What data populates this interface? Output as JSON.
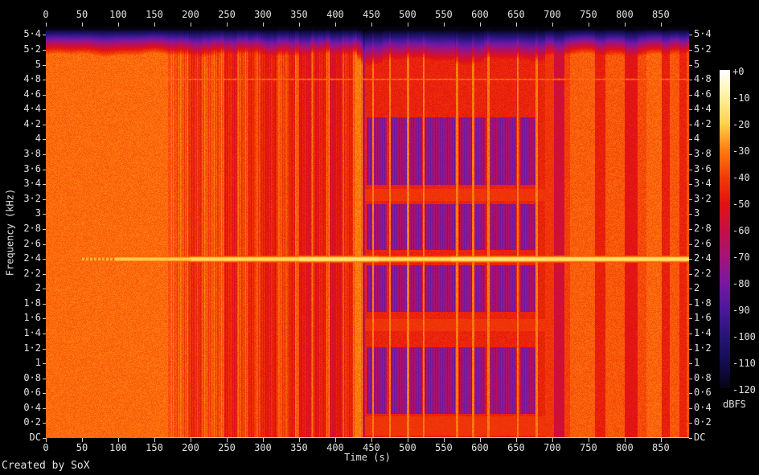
{
  "window": {
    "credit": "Created by SoX",
    "background": "#000000",
    "text_color": "#e2e2e2"
  },
  "chart_data": {
    "type": "heatmap",
    "subtype": "audio-spectrogram",
    "title": "",
    "x_axis": {
      "label": "Time (s)",
      "tick_values": [
        0,
        50,
        100,
        150,
        200,
        250,
        300,
        350,
        400,
        450,
        500,
        550,
        600,
        650,
        700,
        750,
        800,
        850
      ],
      "tick_labels": [
        "0",
        "50",
        "100",
        "150",
        "200",
        "250",
        "300",
        "350",
        "400",
        "450",
        "500",
        "550",
        "600",
        "650",
        "700",
        "750",
        "800",
        "850"
      ],
      "range_s": [
        0,
        889
      ],
      "ticks_on_top_and_bottom": true
    },
    "y_axis": {
      "label": "Frequency (kHz)",
      "tick_values_khz": [
        0,
        0.2,
        0.4,
        0.6,
        0.8,
        1,
        1.2,
        1.4,
        1.6,
        1.8,
        2,
        2.2,
        2.4,
        2.6,
        2.8,
        3,
        3.2,
        3.4,
        3.6,
        3.8,
        4,
        4.2,
        4.4,
        4.6,
        4.8,
        5,
        5.2,
        5.4
      ],
      "tick_labels": [
        "DC",
        "0·2",
        "0·4",
        "0·6",
        "0·8",
        "1",
        "1·2",
        "1·4",
        "1·6",
        "1·8",
        "2",
        "2·2",
        "2·4",
        "2·6",
        "2·8",
        "3",
        "3·2",
        "3·4",
        "3·6",
        "3·8",
        "4",
        "4·2",
        "4·4",
        "4·6",
        "4·8",
        "5",
        "5·2",
        "5·4"
      ],
      "range_khz": [
        0,
        5.5125
      ],
      "labels_on_left_and_right": true
    },
    "colorbar": {
      "label": "dBFS",
      "tick_labels": [
        "+0",
        "-10",
        "-20",
        "-30",
        "-40",
        "-50",
        "-60",
        "-70",
        "-80",
        "-90",
        "-100",
        "-110",
        "-120"
      ],
      "range_db": [
        0,
        -120
      ],
      "palette_stops_db_hex": [
        [
          0,
          "#ffffff"
        ],
        [
          -10,
          "#fff0a0"
        ],
        [
          -20,
          "#ffd24b"
        ],
        [
          -30,
          "#ff7d10"
        ],
        [
          -40,
          "#f23d06"
        ],
        [
          -50,
          "#e31210"
        ],
        [
          -60,
          "#c60f45"
        ],
        [
          -70,
          "#a41374"
        ],
        [
          -80,
          "#7a17a2"
        ],
        [
          -90,
          "#4b189b"
        ],
        [
          -100,
          "#281478"
        ],
        [
          -110,
          "#130d50"
        ],
        [
          -120,
          "#060310"
        ]
      ]
    },
    "features": {
      "description": "Orange broadband noise ~-33dBFS; striped red/dark segments 170-437s; red base with purple grid blocks 441-690s; alternating orange/red bands 690-889s; bright 2.4kHz tone from 50s; faint 4.8kHz tone from ~160s; bright DC line from ~150s; lowpass rolloff to black above ~5.15kHz.",
      "nyquist_hz": 5512.5,
      "time_profile": [
        [
          0,
          168,
          -33
        ],
        [
          168,
          196,
          -36
        ],
        [
          196,
          214,
          -44
        ],
        [
          214,
          246,
          -37
        ],
        [
          246,
          264,
          -47
        ],
        [
          264,
          278,
          -38
        ],
        [
          278,
          290,
          -45
        ],
        [
          290,
          296,
          -37
        ],
        [
          296,
          318,
          -48
        ],
        [
          318,
          334,
          -38
        ],
        [
          334,
          344,
          -46
        ],
        [
          344,
          350,
          -37
        ],
        [
          350,
          366,
          -50
        ],
        [
          366,
          370,
          -38
        ],
        [
          370,
          386,
          -48
        ],
        [
          386,
          392,
          -36
        ],
        [
          392,
          408,
          -52
        ],
        [
          408,
          412,
          -38
        ],
        [
          412,
          424,
          -45
        ],
        [
          424,
          428,
          -38
        ],
        [
          428,
          437,
          -33
        ],
        [
          437,
          441,
          -60
        ],
        [
          441,
          690,
          -46
        ],
        [
          690,
          702,
          -42
        ],
        [
          702,
          716,
          -57
        ],
        [
          716,
          724,
          -40
        ],
        [
          724,
          758,
          -35
        ],
        [
          758,
          773,
          -47
        ],
        [
          773,
          799,
          -36
        ],
        [
          799,
          817,
          -50
        ],
        [
          817,
          830,
          -38
        ],
        [
          830,
          851,
          -34
        ],
        [
          851,
          862,
          -47
        ],
        [
          862,
          875,
          -36
        ],
        [
          875,
          885,
          -46
        ],
        [
          885,
          890,
          -37
        ]
      ],
      "stripe_texture_t_range": [
        168,
        437
      ],
      "transient_times": [
        428,
        431,
        434,
        452,
        475,
        500,
        522,
        568,
        590,
        611,
        652,
        678
      ],
      "transient_level": -31,
      "blocks": {
        "t_ranges": [
          [
            443,
            471
          ],
          [
            476,
            519
          ],
          [
            523,
            565
          ],
          [
            571,
            607
          ],
          [
            614,
            649
          ],
          [
            655,
            676
          ]
        ],
        "bands_khz": [
          [
            0.33,
            1.22
          ],
          [
            1.7,
            2.32
          ],
          [
            2.52,
            3.14
          ],
          [
            3.4,
            4.3
          ]
        ],
        "level": -74,
        "stripe_amp": 9
      },
      "warm_t_range": [
        441,
        690
      ],
      "warm_bands_khz": [
        [
          1.44,
          1.6
        ],
        [
          3.18,
          3.34
        ],
        [
          0.04,
          0.3
        ]
      ],
      "warm_level": -42,
      "line_2400": {
        "freq_hz": 2402,
        "profile": [
          [
            50,
            95,
            -24
          ],
          [
            95,
            200,
            -21
          ],
          [
            200,
            350,
            -18
          ],
          [
            350,
            460,
            -15
          ],
          [
            460,
            560,
            -18
          ],
          [
            560,
            680,
            -15
          ],
          [
            680,
            890,
            -16
          ]
        ]
      },
      "line_4800": {
        "freq_hz": 4810,
        "t_start": 159,
        "level": -30
      },
      "dc_line": {
        "t_start": 148,
        "level": -20
      },
      "rolloff": {
        "edge_hz": 5130,
        "deep_t_range": [
          430,
          690
        ],
        "dip_t_ranges": [
          [
            435,
            465
          ],
          [
            565,
            605
          ]
        ]
      }
    }
  }
}
